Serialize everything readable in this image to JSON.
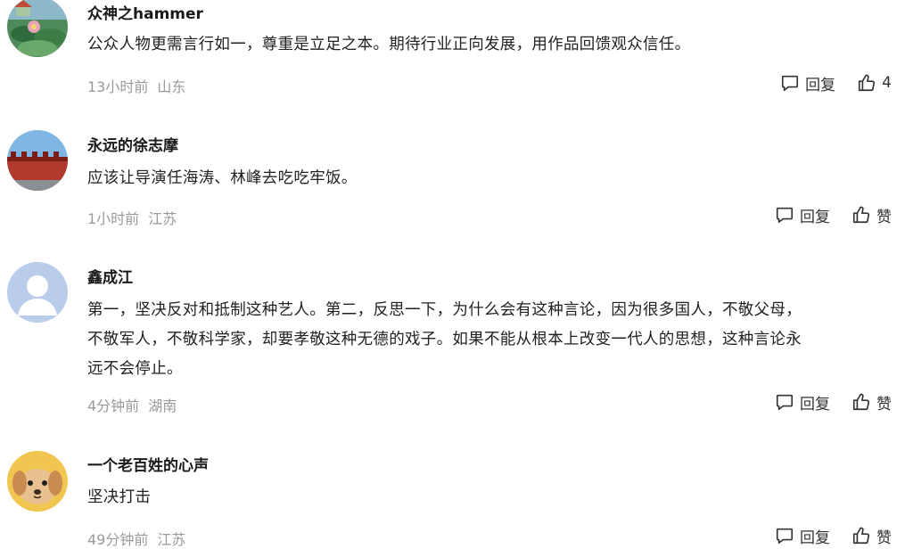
{
  "comments": [
    {
      "username": "众神之hammer",
      "avatar_icon": "lotus-pond-avatar-icon",
      "lines": [
        "公众人物更需言行如一，尊重是立足之本。期待行业正向发展，用作品回馈观众信任。"
      ],
      "time": "13小时前",
      "location": "山东",
      "reply_label": "回复",
      "like_label": "4"
    },
    {
      "username": "永远的徐志摩",
      "avatar_icon": "palace-wall-avatar-icon",
      "lines": [
        "应该让导演任海涛、林峰去吃吃牢饭。"
      ],
      "time": "1小时前",
      "location": "江苏",
      "reply_label": "回复",
      "like_label": "赞"
    },
    {
      "username": "鑫成江",
      "avatar_icon": "default-user-avatar-icon",
      "lines": [
        "第一，坚决反对和抵制这种艺人。第二，反思一下，为什么会有这种言论，因为很多国人，不敬父母，",
        "不敬军人，不敬科学家，却要孝敬这种无德的戏子。如果不能从根本上改变一代人的思想，这种言论永",
        "远不会停止。"
      ],
      "time": "4分钟前",
      "location": "湖南",
      "reply_label": "回复",
      "like_label": "赞"
    },
    {
      "username": "一个老百姓的心声",
      "avatar_icon": "puppy-avatar-icon",
      "lines": [
        "坚决打击"
      ],
      "time": "49分钟前",
      "location": "江苏",
      "reply_label": "回复",
      "like_label": "赞"
    }
  ],
  "colors": {
    "text": "#222222",
    "meta": "#9a9a9a",
    "username": "#1a1a1a"
  }
}
